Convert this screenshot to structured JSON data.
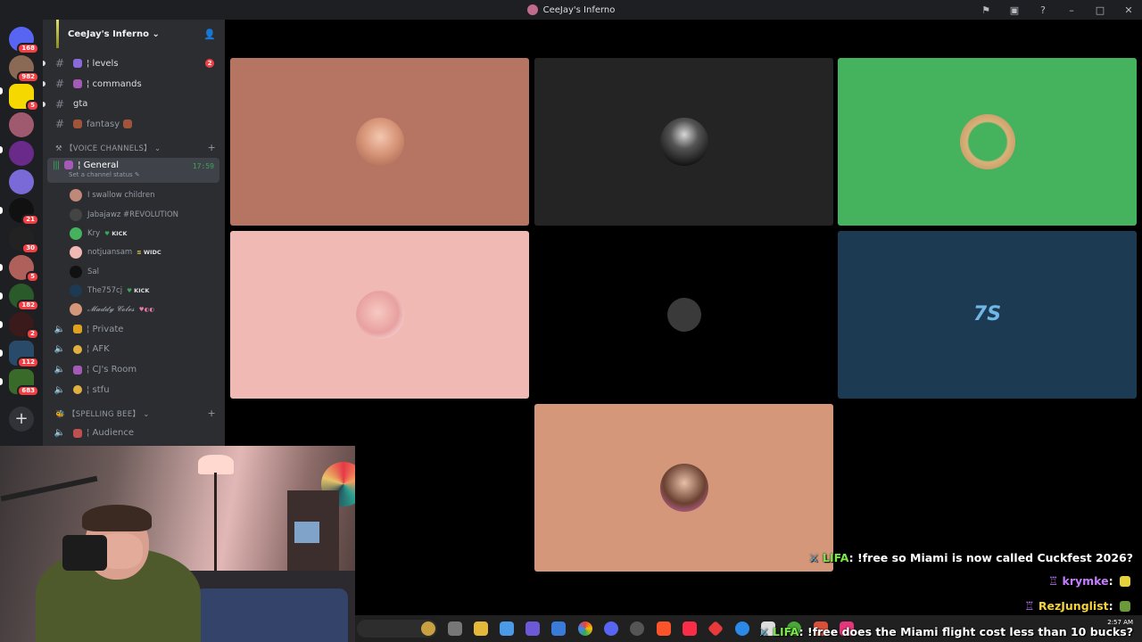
{
  "window": {
    "title": "CeeJay's Inferno"
  },
  "rail": {
    "badges": [
      "168",
      "982",
      "5",
      "21",
      "30",
      "5",
      "182",
      "2",
      "112",
      "683"
    ]
  },
  "guild": {
    "name": "CeeJay's Inferno"
  },
  "channels": [
    {
      "name": "¦ levels",
      "badge": "2"
    },
    {
      "name": "¦ commands"
    },
    {
      "name": "gta"
    },
    {
      "name": "fantasy"
    }
  ],
  "voice_category": {
    "label": "【VOICE CHANNELS】"
  },
  "active_voice": {
    "name": "¦ General",
    "timer": "17:59",
    "status": "Set a channel status"
  },
  "voice_members": [
    {
      "name": "I swallow children",
      "tag": ""
    },
    {
      "name": "Jabajawz #REVOLUTION",
      "tag": ""
    },
    {
      "name": "Kry",
      "tag": "KICK"
    },
    {
      "name": "notjuansam",
      "tag": "WIDC"
    },
    {
      "name": "Sal",
      "tag": ""
    },
    {
      "name": "The757cj",
      "tag": "KICK"
    },
    {
      "name": "𝓜𝓪𝓭𝓭𝔂 𝓒𝓸𝓵𝓮𝓼",
      "tag": ""
    }
  ],
  "voice_channels": [
    {
      "name": "¦ Private"
    },
    {
      "name": "¦ AFK"
    },
    {
      "name": "¦ CJ's Room"
    },
    {
      "name": "¦ stfu"
    }
  ],
  "spelling_category": {
    "label": "【SPELLING BEE】"
  },
  "spelling_channels": [
    {
      "name": "¦ Audience"
    }
  ],
  "colors": {
    "tile1": "#b67463",
    "tile2": "#242424",
    "tile3": "#45b25e",
    "tile4": "#f0b9b3",
    "tile5": "#000000",
    "tile6": "#1d3a53",
    "tile7": "#d4977a",
    "accent_green": "#3ba55d"
  },
  "chat": [
    {
      "user": "LIFA",
      "message": "!free so Miami is now called Cuckfest 2026?"
    },
    {
      "user": "krymke",
      "message": ""
    },
    {
      "user": "RezJunglist",
      "message": ""
    },
    {
      "user": "LIFA",
      "message": "!free does the Miami flight cost less than 10 bucks?"
    }
  ],
  "taskbar": {
    "time": "2:57 AM"
  }
}
